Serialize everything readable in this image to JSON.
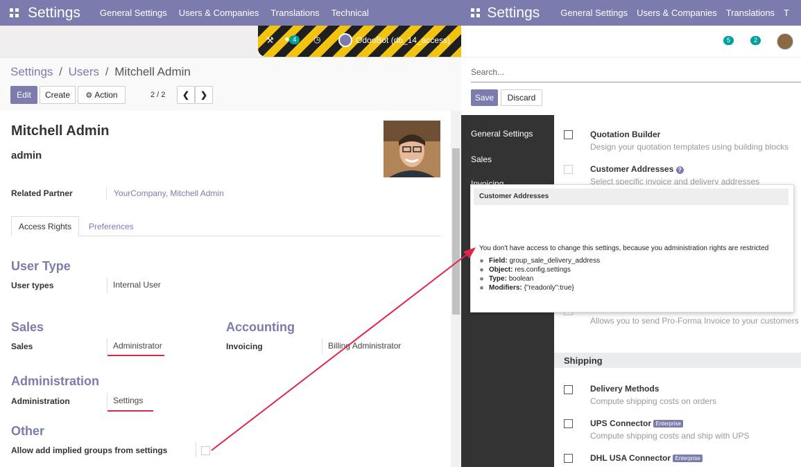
{
  "left": {
    "navbar": {
      "brand": "Settings",
      "menu": [
        "General Settings",
        "Users & Companies",
        "Translations",
        "Technical"
      ]
    },
    "systray": {
      "messages_badge": "4",
      "user_name": "OdooBot (db_14_access)"
    },
    "breadcrumb": {
      "root": "Settings",
      "parent": "Users",
      "current": "Mitchell Admin",
      "sep": "/"
    },
    "buttons": {
      "edit": "Edit",
      "create": "Create",
      "action": "Action"
    },
    "pager": {
      "value": "2 / 2"
    },
    "form": {
      "name": "Mitchell Admin",
      "login": "admin",
      "related_partner_label": "Related Partner",
      "related_partner_value": "YourCompany, Mitchell Admin",
      "tabs": [
        "Access Rights",
        "Preferences"
      ],
      "user_type_title": "User Type",
      "user_types_label": "User types",
      "user_types_value": "Internal User",
      "sales_title": "Sales",
      "sales_label": "Sales",
      "sales_value": "Administrator",
      "accounting_title": "Accounting",
      "invoicing_label": "Invoicing",
      "invoicing_value": "Billing Administrator",
      "administration_title": "Administration",
      "administration_label": "Administration",
      "administration_value": "Settings",
      "other_title": "Other",
      "implied_label": "Allow add implied groups from settings"
    }
  },
  "right": {
    "navbar": {
      "brand": "Settings",
      "menu": [
        "General Settings",
        "Users & Companies",
        "Translations",
        "T"
      ]
    },
    "systray": {
      "badge1": "5",
      "badge2": "2"
    },
    "search_placeholder": "Search...",
    "buttons": {
      "save": "Save",
      "discard": "Discard"
    },
    "sidebar": [
      "General Settings",
      "Sales",
      "Invoicing"
    ],
    "settings": {
      "quotation_title": "Quotation Builder",
      "quotation_desc": "Design your quotation templates using building blocks",
      "customer_addr_title": "Customer Addresses",
      "customer_addr_desc": "Select specific invoice and delivery addresses",
      "proforma_desc": "Allows you to send Pro-Forma Invoice to your customers",
      "shipping_title": "Shipping",
      "delivery_title": "Delivery Methods",
      "delivery_desc": "Compute shipping costs on orders",
      "ups_title": "UPS Connector",
      "ups_desc": "Compute shipping costs and ship with UPS",
      "dhl_title": "DHL USA Connector",
      "enterprise": "Enterprise"
    },
    "tooltip": {
      "title": "Customer Addresses",
      "message": "You don't have access to change this settings, because you administration rights are restricted",
      "field_label": "Field:",
      "field_value": "group_sale_delivery_address",
      "object_label": "Object:",
      "object_value": "res.config.settings",
      "type_label": "Type:",
      "type_value": "boolean",
      "modifiers_label": "Modifiers:",
      "modifiers_value": "{\"readonly\":true}"
    }
  },
  "colors": {
    "brand": "#7c7bad",
    "highlight": "#e0254a",
    "badge": "#00a09d"
  }
}
